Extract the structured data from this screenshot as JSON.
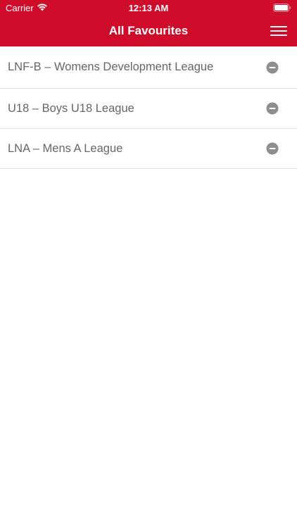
{
  "status_bar": {
    "carrier": "Carrier",
    "time": "12:13 AM",
    "wifi_icon": "wifi-icon",
    "battery_icon": "battery-icon"
  },
  "nav": {
    "title": "All Favourites",
    "menu_icon": "hamburger-menu-icon"
  },
  "favourites": [
    {
      "label": "LNF-B – Womens Development League",
      "action_icon": "remove-icon"
    },
    {
      "label": "U18 – Boys U18 League",
      "action_icon": "remove-icon"
    },
    {
      "label": "LNA – Mens A League",
      "action_icon": "remove-icon"
    }
  ],
  "colors": {
    "header": "#cf0d2b",
    "text": "#666666",
    "remove_icon": "#8e8e8e",
    "separator": "#e1e1e1"
  }
}
